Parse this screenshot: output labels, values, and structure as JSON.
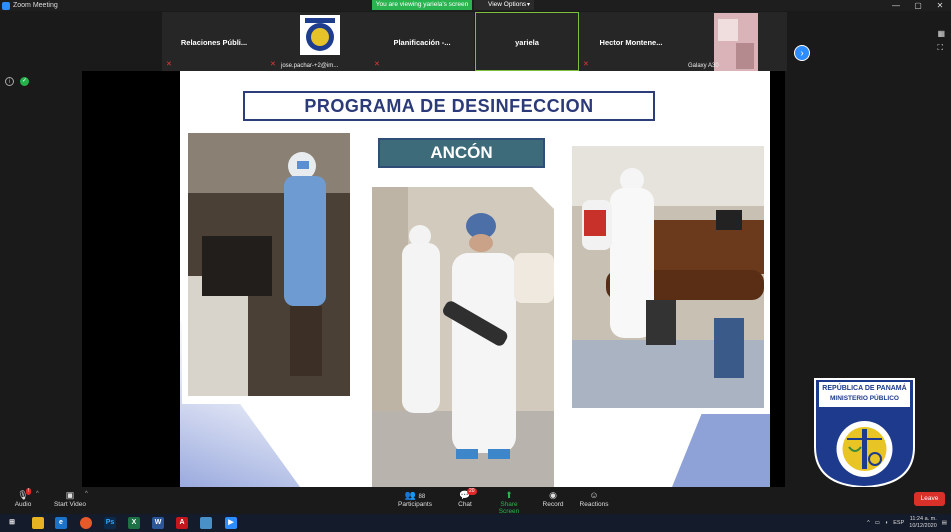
{
  "window": {
    "title": "Zoom Meeting",
    "controls": [
      "—",
      "▢",
      "✕"
    ]
  },
  "share_banner": {
    "viewing": "You are viewing yariela's screen",
    "view_options": "View Options"
  },
  "participants": [
    {
      "name": "Relaciones  Públi...",
      "muted": true
    },
    {
      "name": "",
      "label": "jose.pachar-+2@im...",
      "muted": true,
      "has_logo": true
    },
    {
      "name": "Planificación  -...",
      "muted": true
    },
    {
      "name": "yariela",
      "muted": false,
      "active": true
    },
    {
      "name": "Hector  Montene...",
      "muted": true
    },
    {
      "name": "",
      "label": "Galaxy A30",
      "muted": false,
      "has_photo": true
    }
  ],
  "slide": {
    "title": "PROGRAMA DE DESINFECCION",
    "subtitle": "ANCÓN"
  },
  "logo": {
    "top_line1": "REPÚBLICA DE PANAMÁ",
    "top_line2": "MINISTERIO PÚBLICO",
    "ring_text": "INSTITUTO DE MEDICINA LEGAL Y CIENCIAS FORENSES"
  },
  "controls": {
    "audio": "Audio",
    "start_video": "Start Video",
    "participants": "Participants",
    "participants_count": "88",
    "chat": "Chat",
    "chat_badge": "20",
    "share_screen": "Share Screen",
    "record": "Record",
    "reactions": "Reactions",
    "leave": "Leave"
  },
  "taskbar": {
    "language": "ESP",
    "time": "11:24 a. m.",
    "date": "10/12/2020"
  }
}
